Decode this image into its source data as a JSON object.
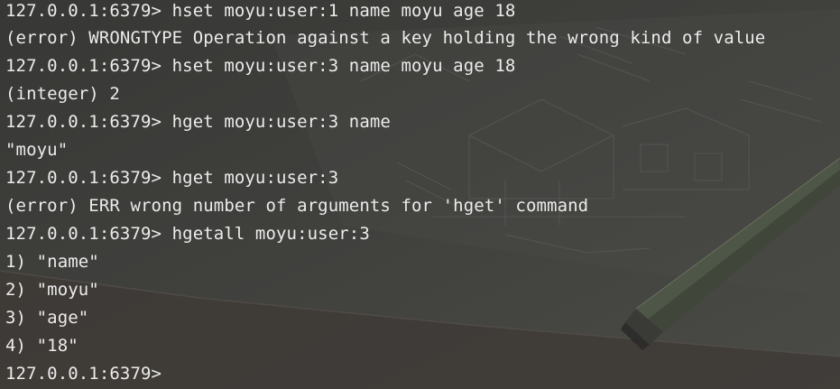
{
  "terminal": {
    "lines": [
      "127.0.0.1:6379> hset moyu:user:1 name moyu age 18",
      "(error) WRONGTYPE Operation against a key holding the wrong kind of value",
      "127.0.0.1:6379> hset moyu:user:3 name moyu age 18",
      "(integer) 2",
      "127.0.0.1:6379> hget moyu:user:3 name",
      "\"moyu\"",
      "127.0.0.1:6379> hget moyu:user:3",
      "(error) ERR wrong number of arguments for 'hget' command",
      "127.0.0.1:6379> hgetall moyu:user:3",
      "1) \"name\"",
      "2) \"moyu\"",
      "3) \"age\"",
      "4) \"18\"",
      "127.0.0.1:6379>"
    ]
  },
  "colors": {
    "background": "#3b3b39",
    "text": "#ececec"
  }
}
